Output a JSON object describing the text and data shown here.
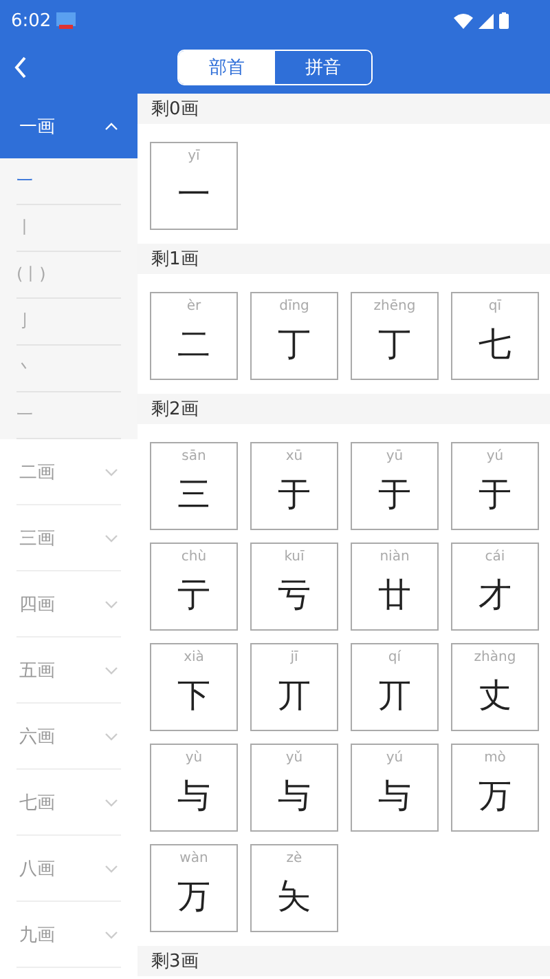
{
  "status_bar": {
    "time": "6:02"
  },
  "segments": [
    {
      "label": "部首",
      "selected": true
    },
    {
      "label": "拼音",
      "selected": false
    }
  ],
  "groups": [
    {
      "label": "一画",
      "expanded": true,
      "children": [
        {
          "label": "一",
          "selected": true
        },
        {
          "label": "丨",
          "selected": false
        },
        {
          "label": "(丨)",
          "selected": false
        },
        {
          "label": "亅",
          "selected": false
        },
        {
          "label": "丶",
          "selected": false
        },
        {
          "label": "一",
          "selected": false
        }
      ]
    },
    {
      "label": "二画",
      "expanded": false
    },
    {
      "label": "三画",
      "expanded": false
    },
    {
      "label": "四画",
      "expanded": false
    },
    {
      "label": "五画",
      "expanded": false
    },
    {
      "label": "六画",
      "expanded": false
    },
    {
      "label": "七画",
      "expanded": false
    },
    {
      "label": "八画",
      "expanded": false
    },
    {
      "label": "九画",
      "expanded": false
    }
  ],
  "sections": [
    {
      "title": "剩0画",
      "chars": [
        {
          "pinyin": "yī",
          "char": "一"
        }
      ]
    },
    {
      "title": "剩1画",
      "chars": [
        {
          "pinyin": "èr",
          "char": "二"
        },
        {
          "pinyin": "dīng",
          "char": "丁"
        },
        {
          "pinyin": "zhēng",
          "char": "丁"
        },
        {
          "pinyin": "qī",
          "char": "七"
        }
      ]
    },
    {
      "title": "剩2画",
      "chars": [
        {
          "pinyin": "sān",
          "char": "三"
        },
        {
          "pinyin": "xū",
          "char": "于"
        },
        {
          "pinyin": "yū",
          "char": "于"
        },
        {
          "pinyin": "yú",
          "char": "于"
        },
        {
          "pinyin": "chù",
          "char": "亍"
        },
        {
          "pinyin": "kuī",
          "char": "亏"
        },
        {
          "pinyin": "niàn",
          "char": "廿"
        },
        {
          "pinyin": "cái",
          "char": "才"
        },
        {
          "pinyin": "xià",
          "char": "下"
        },
        {
          "pinyin": "jī",
          "char": "丌"
        },
        {
          "pinyin": "qí",
          "char": "丌"
        },
        {
          "pinyin": "zhàng",
          "char": "丈"
        },
        {
          "pinyin": "yù",
          "char": "与"
        },
        {
          "pinyin": "yǔ",
          "char": "与"
        },
        {
          "pinyin": "yú",
          "char": "与"
        },
        {
          "pinyin": "mò",
          "char": "万"
        },
        {
          "pinyin": "wàn",
          "char": "万"
        },
        {
          "pinyin": "zè",
          "char": "夨"
        }
      ]
    },
    {
      "title": "剩3画"
    }
  ]
}
